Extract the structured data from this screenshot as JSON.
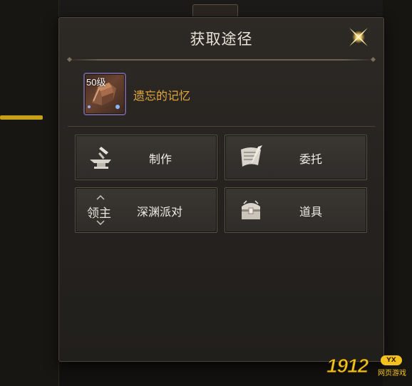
{
  "dialog": {
    "title": "获取途径",
    "item": {
      "level": "50级",
      "name": "遗忘的记忆"
    },
    "options": [
      {
        "label": "制作",
        "icon": "anvil-icon"
      },
      {
        "label": "委托",
        "icon": "scroll-quill-icon"
      },
      {
        "label": "深渊派对",
        "icon": "lord-badge-icon",
        "badge": "领主"
      },
      {
        "label": "道具",
        "icon": "treasure-chest-icon"
      }
    ]
  },
  "watermark": {
    "number": "1912",
    "badge": "YX",
    "sub": "网页游戏"
  },
  "colors": {
    "accent_gold": "#e6a93c",
    "title": "#e9e4d8",
    "button_bg": "#34312d"
  }
}
